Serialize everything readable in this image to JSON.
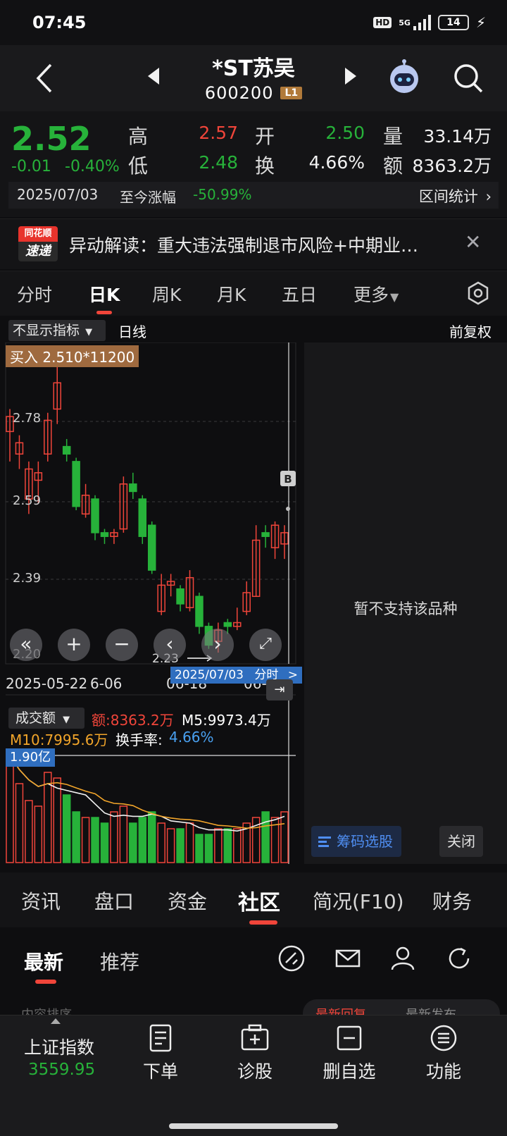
{
  "status": {
    "time": "07:45",
    "hd": "HD",
    "net": "5G",
    "battery": "14"
  },
  "header": {
    "name": "*ST苏吴",
    "code": "600200",
    "level": "L1"
  },
  "quote": {
    "price": "2.52",
    "change": "-0.01",
    "change_pct": "-0.40%",
    "high_label": "高",
    "high": "2.57",
    "open_label": "开",
    "open": "2.50",
    "vol_label": "量",
    "vol": "33.14万",
    "low_label": "低",
    "low": "2.48",
    "turn_label": "换",
    "turn": "4.66%",
    "amt_label": "额",
    "amt": "8363.2万",
    "date": "2025/07/03",
    "since_label": "至今涨幅",
    "since_value": "-50.99%",
    "range_stats": "区间统计"
  },
  "news": {
    "logo_top": "同花顺",
    "logo_bottom": "速递",
    "text": "异动解读：重大违法强制退市风险+中期业…"
  },
  "period_tabs": [
    "分时",
    "日K",
    "周K",
    "月K",
    "五日",
    "更多"
  ],
  "chart": {
    "indicator": "不显示指标",
    "period": "日线",
    "adjust": "前复权",
    "buy_tag": "买入 2.510*11200",
    "price_labels": [
      "2.78",
      "2.59",
      "2.39",
      "2.20"
    ],
    "low_marker": "2.23",
    "b_marker": "B",
    "dates": [
      "2025-05-22",
      "6-06",
      "06-18",
      "06-"
    ],
    "cursor_date": "2025/07/03",
    "cursor_mode": "分时",
    "unsupported": "暂不支持该品种",
    "chip_select": "筹码选股",
    "close": "关闭",
    "volume": {
      "indicator": "成交额",
      "amt": "额:8363.2万",
      "m5": "M5:9973.4万",
      "m10": "M10:7995.6万",
      "turnover_label": "换手率:",
      "turnover": "4.66%",
      "max_tag": "1.90亿"
    }
  },
  "section_tabs": [
    "资讯",
    "盘口",
    "资金",
    "社区",
    "简况(F10)",
    "财务"
  ],
  "sub_tabs": {
    "latest": "最新",
    "recommend": "推荐"
  },
  "peek": {
    "sort": "内容排序",
    "reply": "最新回复",
    "post": "最新发布"
  },
  "bottom_nav": {
    "index_name": "上证指数",
    "index_value": "3559.95",
    "items": [
      "下单",
      "诊股",
      "删自选",
      "功能"
    ]
  },
  "colors": {
    "up": "#f0453a",
    "down": "#27b23a",
    "accent": "#2f6ebf"
  }
}
